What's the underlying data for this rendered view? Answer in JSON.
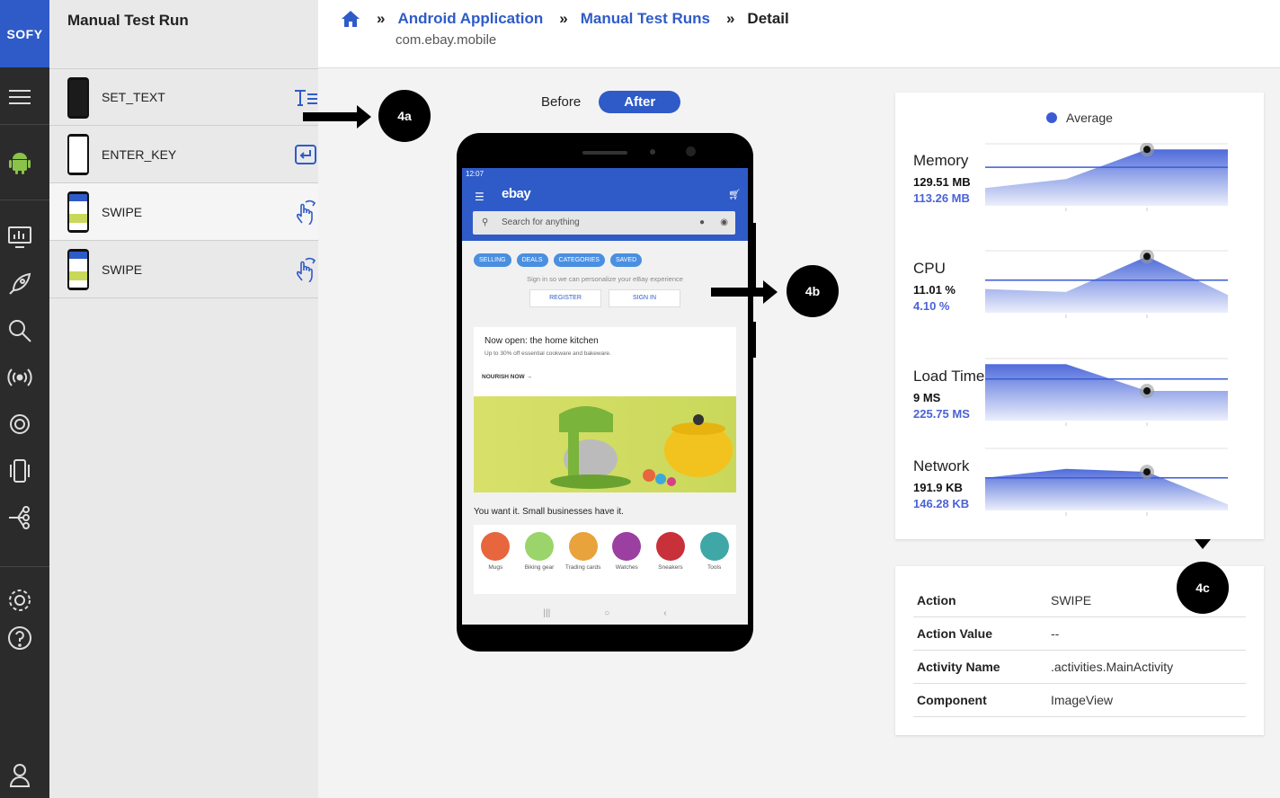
{
  "brand": "SOFY",
  "steps_panel": {
    "title": "Manual Test Run",
    "steps": [
      {
        "label": "SET_TEXT",
        "action_icon": "text-input-icon"
      },
      {
        "label": "ENTER_KEY",
        "action_icon": "enter-key-icon"
      },
      {
        "label": "SWIPE",
        "action_icon": "swipe-hand-icon",
        "active": true
      },
      {
        "label": "SWIPE",
        "action_icon": "swipe-hand-icon"
      }
    ]
  },
  "breadcrumb": {
    "items": [
      "Android Application",
      "Manual Test Runs"
    ],
    "current": "Detail",
    "package": "com.ebay.mobile"
  },
  "toggle": {
    "before": "Before",
    "after": "After",
    "selected": "After"
  },
  "phone_screen": {
    "time": "12:07",
    "app_logo": "ebay",
    "search_placeholder": "Search for anything",
    "chips": [
      "SELLING",
      "DEALS",
      "CATEGORIES",
      "SAVED"
    ],
    "signin_prompt": "Sign in so we can personalize your eBay experience",
    "register": "REGISTER",
    "sign_in": "SIGN IN",
    "card_title": "Now open: the home kitchen",
    "card_sub": "Up to 30% off essential cookware and bakeware.",
    "card_link": "NOURISH NOW",
    "small_biz": "You want it. Small businesses have it.",
    "categories": [
      {
        "name": "Mugs",
        "color": "#e8663d"
      },
      {
        "name": "Biking gear",
        "color": "#9ad46b"
      },
      {
        "name": "Trading cards",
        "color": "#e8a33d"
      },
      {
        "name": "Watches",
        "color": "#9b3fa0"
      },
      {
        "name": "Sneakers",
        "color": "#c8303a"
      },
      {
        "name": "Tools",
        "color": "#3fa8a6"
      }
    ]
  },
  "markers": {
    "a": "4a",
    "b": "4b",
    "c": "4c"
  },
  "metrics": {
    "legend": "Average",
    "accent": "#3b5bd6",
    "items": [
      {
        "name": "Memory",
        "value": "129.51 MB",
        "avg": "113.26 MB",
        "series": [
          0.3,
          0.45,
          0.95,
          0.95
        ],
        "avg_level": 0.65,
        "current_index": 2
      },
      {
        "name": "CPU",
        "value": "11.01 %",
        "avg": "4.10 %",
        "series": [
          0.4,
          0.35,
          0.95,
          0.3
        ],
        "avg_level": 0.55,
        "current_index": 2
      },
      {
        "name": "Load Time",
        "value": "9 MS",
        "avg": "225.75 MS",
        "series": [
          0.95,
          0.95,
          0.5,
          0.5
        ],
        "avg_level": 0.7,
        "current_index": 2
      },
      {
        "name": "Network",
        "value": "191.9 KB",
        "avg": "146.28 KB",
        "series": [
          0.55,
          0.7,
          0.65,
          0.1
        ],
        "avg_level": 0.55,
        "current_index": 2
      }
    ]
  },
  "details": [
    {
      "key": "Action",
      "value": "SWIPE"
    },
    {
      "key": "Action Value",
      "value": "--"
    },
    {
      "key": "Activity Name",
      "value": ".activities.MainActivity"
    },
    {
      "key": "Component",
      "value": "ImageView"
    }
  ]
}
